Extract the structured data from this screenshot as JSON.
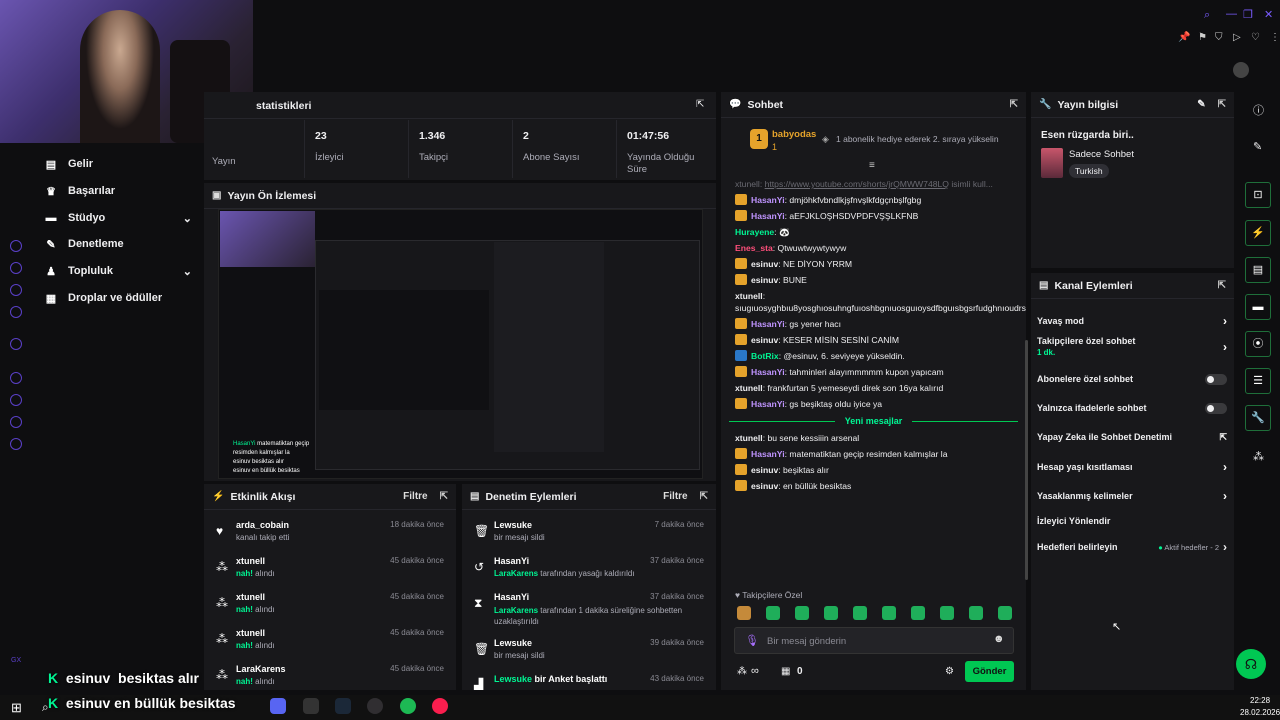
{
  "brand": {
    "accent": "#00f593",
    "panel_bg": "#18181b",
    "bg": "#0e0e10",
    "purple": "#bf94ff",
    "send_green": "#00c853"
  },
  "stats": {
    "title": "statistikleri",
    "items": [
      {
        "value": "",
        "label": "Yayın"
      },
      {
        "value": "23",
        "label": "İzleyici"
      },
      {
        "value": "1.346",
        "label": "Takipçi"
      },
      {
        "value": "2",
        "label": "Abone Sayısı"
      },
      {
        "value": "01:47:56",
        "label": "Yayında Olduğu Süre"
      }
    ]
  },
  "preview": {
    "title": "Yayın Ön İzlemesi"
  },
  "sidebar": {
    "items": [
      {
        "label": "Gelir",
        "icon": "money-icon"
      },
      {
        "label": "Başarılar",
        "icon": "trophy-icon"
      },
      {
        "label": "Stüdyo",
        "icon": "studio-icon"
      },
      {
        "label": "Denetleme",
        "icon": "hammer-icon"
      },
      {
        "label": "Topluluk",
        "icon": "users-icon"
      },
      {
        "label": "Droplar ve ödüller",
        "icon": "gift-icon"
      }
    ]
  },
  "activity": {
    "title": "Etkinlik Akışı",
    "filter": "Filtre",
    "rows": [
      {
        "name": "arda_cobain",
        "sub": "kanalı takip etti",
        "time": "18 dakika önce",
        "icon": "heart-icon"
      },
      {
        "name": "xtunell",
        "sub_green": "nah!",
        "sub": " alındı",
        "time": "45 dakika önce",
        "icon": "points-icon"
      },
      {
        "name": "xtunell",
        "sub_green": "nah!",
        "sub": " alındı",
        "time": "45 dakika önce",
        "icon": "points-icon"
      },
      {
        "name": "xtunell",
        "sub_green": "nah!",
        "sub": " alındı",
        "time": "45 dakika önce",
        "icon": "points-icon"
      },
      {
        "name": "LaraKarens",
        "sub_green": "nah!",
        "sub": " alındı",
        "time": "45 dakika önce",
        "icon": "points-icon"
      }
    ]
  },
  "moderation": {
    "title": "Denetim Eylemleri",
    "filter": "Filtre",
    "rows": [
      {
        "name": "Lewsuke",
        "sub": "bir mesajı sildi",
        "time": "7 dakika önce",
        "icon": "trash-icon"
      },
      {
        "name": "HasanYi",
        "sub_green": "LaraKarens",
        "sub": " tarafından yasağı kaldırıldı",
        "time": "37 dakika önce",
        "icon": "undo-icon"
      },
      {
        "name": "HasanYi",
        "sub_green": "LaraKarens",
        "sub": " tarafından 1 dakika süreliğine sohbetten uzaklaştırıldı",
        "time": "37 dakika önce",
        "icon": "hourglass-icon"
      },
      {
        "name": "Lewsuke",
        "sub": "bir mesajı sildi",
        "time": "39 dakika önce",
        "icon": "trash-icon"
      },
      {
        "name_green": "Lewsuke",
        "name_rest": " bir Anket başlattı",
        "time": "43 dakika önce",
        "icon": "poll-icon"
      }
    ]
  },
  "chat": {
    "title": "Sohbet",
    "pinned_user": "babyodas",
    "pinned_count": "1",
    "pinned_msg": "1 abonelik hediye ederek 2. sıraya yükselin",
    "link_line_user": "xtunell:",
    "link_line_url": "https://www.youtube.com/shorts/jrQMWW748LQ",
    "link_line_rest": " isimli kull...",
    "messages": [
      {
        "user": "HasanYi",
        "color": "#bf94ff",
        "badge": "sub",
        "text": "dmjöhkfvbndlkjşfnvşlkfdgçnbşlfgbg"
      },
      {
        "user": "HasanYi",
        "color": "#bf94ff",
        "badge": "sub",
        "text": "aEFJKLOŞHSDVPDFVŞŞLKFNB"
      },
      {
        "user": "Hurayene",
        "color": "#00f593",
        "badge": "",
        "text": "🐼"
      },
      {
        "user": "Enes_sta",
        "color": "#ff4f7b",
        "badge": "",
        "text": "Qtwuwtwywtywyw"
      },
      {
        "user": "esinuv",
        "color": "#efeff1",
        "badge": "sub",
        "text": "NE DİYON YRRM"
      },
      {
        "user": "esinuv",
        "color": "#efeff1",
        "badge": "sub",
        "text": "BUNE"
      },
      {
        "user": "xtunell",
        "color": "#efeff1",
        "badge": "",
        "text": "sıugıuosyghbıu8yosghıosuhngfuıoshbgnıuosguıoysdfbguısbgsrfudghnıoudrsghnudrfg"
      },
      {
        "user": "HasanYi",
        "color": "#bf94ff",
        "badge": "sub",
        "text": "gs yener hacı"
      },
      {
        "user": "esinuv",
        "color": "#efeff1",
        "badge": "sub",
        "text": "KESER MİSİN SESİNİ CANİM"
      },
      {
        "user": "BotRix",
        "color": "#00f593",
        "badge": "bot",
        "text": "@esinuv, 6. seviyeye yükseldin."
      },
      {
        "user": "HasanYi",
        "color": "#bf94ff",
        "badge": "sub",
        "text": "tahminleri alayımmmmm kupon yapıcam"
      },
      {
        "user": "xtunell",
        "color": "#efeff1",
        "badge": "",
        "text": "frankfurtan 5 yemeseydi direk son 16ya kalırıd"
      },
      {
        "user": "HasanYi",
        "color": "#bf94ff",
        "badge": "sub",
        "text": "gs beşiktaş oldu iyice ya"
      }
    ],
    "new_messages_label": "Yeni mesajlar",
    "new_messages": [
      {
        "user": "xtunell",
        "color": "#efeff1",
        "badge": "",
        "text": "bu sene kessiiin arsenal"
      },
      {
        "user": "HasanYi",
        "color": "#bf94ff",
        "badge": "sub",
        "text": "matematiktan geçip resimden kalmışlar la"
      },
      {
        "user": "esinuv",
        "color": "#efeff1",
        "badge": "sub",
        "text": "beşiktas alır"
      },
      {
        "user": "esinuv",
        "color": "#efeff1",
        "badge": "sub",
        "text": "en büllük besiktas"
      }
    ],
    "followers_only": "Takipçilere Özel",
    "input_placeholder": "Bir mesaj gönderin",
    "points": "∞",
    "gifts": "0",
    "send": "Gönder"
  },
  "stream_info": {
    "title": "Yayın bilgisi",
    "stream_title": "Esen rüzgarda biri..",
    "category": "Sadece Sohbet",
    "tag": "Turkish"
  },
  "channel_actions": {
    "title": "Kanal Eylemleri",
    "rows": [
      {
        "label": "Yavaş mod",
        "type": "chevron"
      },
      {
        "label": "Takipçilere özel sohbet",
        "extra": "1 dk.",
        "type": "chevron"
      },
      {
        "label": "Abonelere özel sohbet",
        "type": "toggle"
      },
      {
        "label": "Yalnızca ifadelerle sohbet",
        "type": "toggle"
      },
      {
        "label": "Yapay Zeka ile Sohbet Denetimi",
        "type": "external"
      },
      {
        "label": "Hesap yaşı kısıtlaması",
        "type": "chevron"
      },
      {
        "label": "Yasaklanmış kelimeler",
        "type": "chevron"
      },
      {
        "label": "İzleyici Yönlendir",
        "type": "none"
      },
      {
        "label": "Hedefleri belirleyin",
        "status": "Aktif hedefler - 2",
        "type": "chevron"
      }
    ]
  },
  "overlay": {
    "line1_user": "esinuv",
    "line1_text": "besiktas alır",
    "line2_user": "esinuv",
    "line2_text": "en büllük besiktas"
  },
  "taskbar": {
    "time": "22:28",
    "date": "28.02.2026"
  }
}
